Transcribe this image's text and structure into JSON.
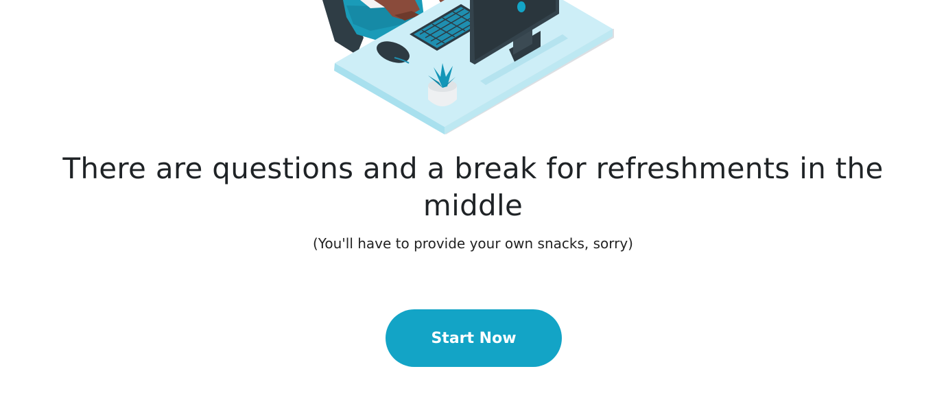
{
  "illustration": {
    "subject": "person-at-desk-computer",
    "colors": {
      "desk_top": "#cdeef7",
      "desk_edge": "#a8e0ee",
      "monitor": "#34434c",
      "accent": "#13a4c6",
      "plant": "#1396b8"
    }
  },
  "main": {
    "headline": "There are questions and a break for refreshments in the middle",
    "subtext": "(You'll have to provide your own snacks, sorry)"
  },
  "cta": {
    "label": "Start Now",
    "color": "#13a4c6"
  }
}
